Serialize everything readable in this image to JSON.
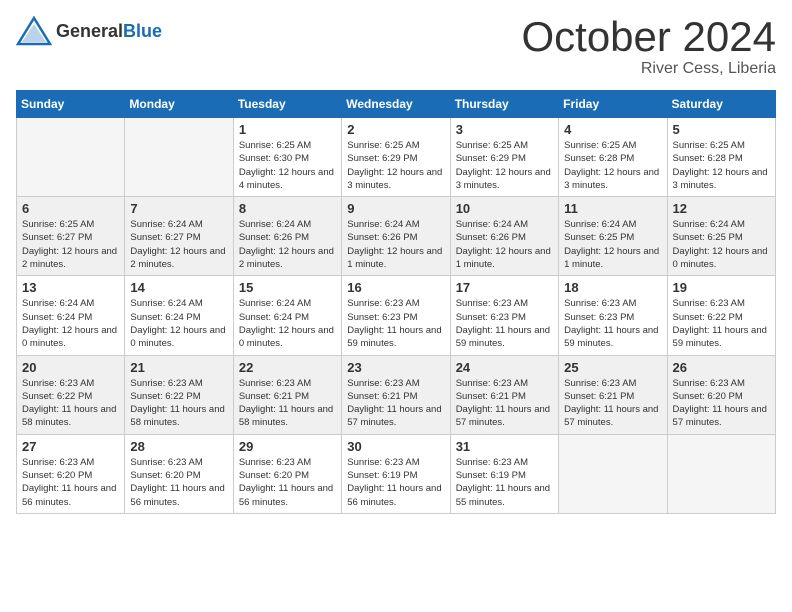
{
  "logo": {
    "general": "General",
    "blue": "Blue"
  },
  "title": {
    "month_year": "October 2024",
    "location": "River Cess, Liberia"
  },
  "headers": [
    "Sunday",
    "Monday",
    "Tuesday",
    "Wednesday",
    "Thursday",
    "Friday",
    "Saturday"
  ],
  "weeks": [
    [
      {
        "day": "",
        "info": ""
      },
      {
        "day": "",
        "info": ""
      },
      {
        "day": "1",
        "info": "Sunrise: 6:25 AM\nSunset: 6:30 PM\nDaylight: 12 hours and 4 minutes."
      },
      {
        "day": "2",
        "info": "Sunrise: 6:25 AM\nSunset: 6:29 PM\nDaylight: 12 hours and 3 minutes."
      },
      {
        "day": "3",
        "info": "Sunrise: 6:25 AM\nSunset: 6:29 PM\nDaylight: 12 hours and 3 minutes."
      },
      {
        "day": "4",
        "info": "Sunrise: 6:25 AM\nSunset: 6:28 PM\nDaylight: 12 hours and 3 minutes."
      },
      {
        "day": "5",
        "info": "Sunrise: 6:25 AM\nSunset: 6:28 PM\nDaylight: 12 hours and 3 minutes."
      }
    ],
    [
      {
        "day": "6",
        "info": "Sunrise: 6:25 AM\nSunset: 6:27 PM\nDaylight: 12 hours and 2 minutes."
      },
      {
        "day": "7",
        "info": "Sunrise: 6:24 AM\nSunset: 6:27 PM\nDaylight: 12 hours and 2 minutes."
      },
      {
        "day": "8",
        "info": "Sunrise: 6:24 AM\nSunset: 6:26 PM\nDaylight: 12 hours and 2 minutes."
      },
      {
        "day": "9",
        "info": "Sunrise: 6:24 AM\nSunset: 6:26 PM\nDaylight: 12 hours and 1 minute."
      },
      {
        "day": "10",
        "info": "Sunrise: 6:24 AM\nSunset: 6:26 PM\nDaylight: 12 hours and 1 minute."
      },
      {
        "day": "11",
        "info": "Sunrise: 6:24 AM\nSunset: 6:25 PM\nDaylight: 12 hours and 1 minute."
      },
      {
        "day": "12",
        "info": "Sunrise: 6:24 AM\nSunset: 6:25 PM\nDaylight: 12 hours and 0 minutes."
      }
    ],
    [
      {
        "day": "13",
        "info": "Sunrise: 6:24 AM\nSunset: 6:24 PM\nDaylight: 12 hours and 0 minutes."
      },
      {
        "day": "14",
        "info": "Sunrise: 6:24 AM\nSunset: 6:24 PM\nDaylight: 12 hours and 0 minutes."
      },
      {
        "day": "15",
        "info": "Sunrise: 6:24 AM\nSunset: 6:24 PM\nDaylight: 12 hours and 0 minutes."
      },
      {
        "day": "16",
        "info": "Sunrise: 6:23 AM\nSunset: 6:23 PM\nDaylight: 11 hours and 59 minutes."
      },
      {
        "day": "17",
        "info": "Sunrise: 6:23 AM\nSunset: 6:23 PM\nDaylight: 11 hours and 59 minutes."
      },
      {
        "day": "18",
        "info": "Sunrise: 6:23 AM\nSunset: 6:23 PM\nDaylight: 11 hours and 59 minutes."
      },
      {
        "day": "19",
        "info": "Sunrise: 6:23 AM\nSunset: 6:22 PM\nDaylight: 11 hours and 59 minutes."
      }
    ],
    [
      {
        "day": "20",
        "info": "Sunrise: 6:23 AM\nSunset: 6:22 PM\nDaylight: 11 hours and 58 minutes."
      },
      {
        "day": "21",
        "info": "Sunrise: 6:23 AM\nSunset: 6:22 PM\nDaylight: 11 hours and 58 minutes."
      },
      {
        "day": "22",
        "info": "Sunrise: 6:23 AM\nSunset: 6:21 PM\nDaylight: 11 hours and 58 minutes."
      },
      {
        "day": "23",
        "info": "Sunrise: 6:23 AM\nSunset: 6:21 PM\nDaylight: 11 hours and 57 minutes."
      },
      {
        "day": "24",
        "info": "Sunrise: 6:23 AM\nSunset: 6:21 PM\nDaylight: 11 hours and 57 minutes."
      },
      {
        "day": "25",
        "info": "Sunrise: 6:23 AM\nSunset: 6:21 PM\nDaylight: 11 hours and 57 minutes."
      },
      {
        "day": "26",
        "info": "Sunrise: 6:23 AM\nSunset: 6:20 PM\nDaylight: 11 hours and 57 minutes."
      }
    ],
    [
      {
        "day": "27",
        "info": "Sunrise: 6:23 AM\nSunset: 6:20 PM\nDaylight: 11 hours and 56 minutes."
      },
      {
        "day": "28",
        "info": "Sunrise: 6:23 AM\nSunset: 6:20 PM\nDaylight: 11 hours and 56 minutes."
      },
      {
        "day": "29",
        "info": "Sunrise: 6:23 AM\nSunset: 6:20 PM\nDaylight: 11 hours and 56 minutes."
      },
      {
        "day": "30",
        "info": "Sunrise: 6:23 AM\nSunset: 6:19 PM\nDaylight: 11 hours and 56 minutes."
      },
      {
        "day": "31",
        "info": "Sunrise: 6:23 AM\nSunset: 6:19 PM\nDaylight: 11 hours and 55 minutes."
      },
      {
        "day": "",
        "info": ""
      },
      {
        "day": "",
        "info": ""
      }
    ]
  ]
}
